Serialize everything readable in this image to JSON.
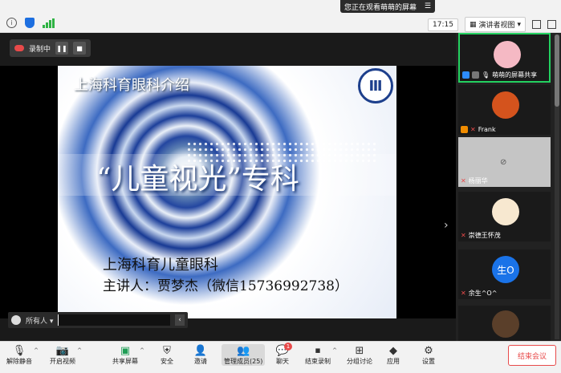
{
  "topbar": {
    "watching_banner": "您正在观看萌萌的屏幕",
    "time": "17:15",
    "view_mode": "演讲者视图"
  },
  "recording": {
    "label": "录制中"
  },
  "slide": {
    "header": "上海科育眼科介绍",
    "title": "“儿童视光”专科",
    "line1": "上海科育儿童眼科",
    "line2": "主讲人：贾梦杰（微信15736992738）"
  },
  "chat": {
    "recipient": "所有人"
  },
  "participants": [
    {
      "name": "萌萌的屏幕共享",
      "kind": "avatar"
    },
    {
      "name": "Frank",
      "kind": "avatar"
    },
    {
      "name": "杨丽华",
      "kind": "video-off"
    },
    {
      "name": "崇德王怀茂",
      "kind": "avatar"
    },
    {
      "name": "余生^O^",
      "kind": "initials",
      "initials": "生O"
    }
  ],
  "toolbar": {
    "unmute": "解除静音",
    "start_video": "开启视频",
    "share_screen": "共享屏幕",
    "security": "安全",
    "invite": "邀请",
    "manage_participants": "管理成员(25)",
    "chat": "聊天",
    "chat_badge": "1",
    "end_recording": "结束录制",
    "breakout": "分组讨论",
    "apps": "应用",
    "settings": "设置",
    "end_meeting": "结束会议"
  },
  "colors": {
    "accent_green": "#23d160",
    "alert_red": "#e84a4a",
    "brand_blue": "#1d3f8c"
  }
}
